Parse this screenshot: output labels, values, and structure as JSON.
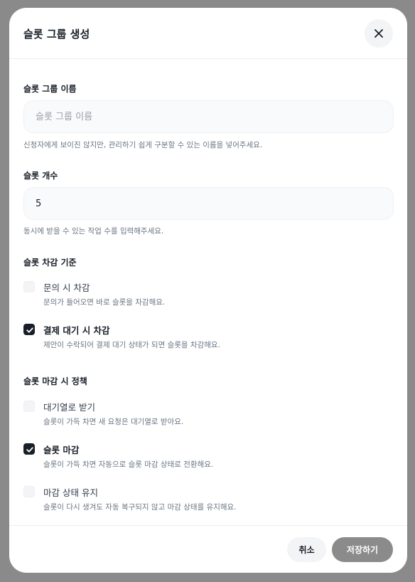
{
  "modal": {
    "title": "슬롯 그룹 생성",
    "close_icon": "close-icon"
  },
  "group_name": {
    "label": "슬롯 그룹 이름",
    "placeholder": "슬롯 그룹 이름",
    "value": "",
    "help": "신청자에게 보이진 않지만, 관리하기 쉽게 구분할 수 있는 이름을 넣어주세요."
  },
  "slot_count": {
    "label": "슬롯 개수",
    "value": "5",
    "help": "동시에 받을 수 있는 작업 수를 입력해주세요."
  },
  "deduction": {
    "label": "슬롯 차감 기준",
    "options": [
      {
        "title": "문의 시 차감",
        "desc": "문의가 들어오면 바로 슬롯을 차감해요.",
        "checked": false
      },
      {
        "title": "결제 대기 시 차감",
        "desc": "제안이 수락되어 결제 대기 상태가 되면 슬롯을 차감해요.",
        "checked": true
      }
    ]
  },
  "closing_policy": {
    "label": "슬롯 마감 시 정책",
    "options": [
      {
        "title": "대기열로 받기",
        "desc": "슬롯이 가득 차면 새 요청은 대기열로 받아요.",
        "checked": false
      },
      {
        "title": "슬롯 마감",
        "desc": "슬롯이 가득 차면 자동으로 슬롯 마감 상태로 전환해요.",
        "checked": true
      },
      {
        "title": "마감 상태 유지",
        "desc": "슬롯이 다시 생겨도 자동 복구되지 않고 마감 상태를 유지해요.",
        "checked": false
      }
    ]
  },
  "footer": {
    "cancel_label": "취소",
    "save_label": "저장하기"
  },
  "colors": {
    "checked": "#191f28",
    "save_disabled": "#8b8b8b",
    "overlay": "#8a8a8a"
  }
}
